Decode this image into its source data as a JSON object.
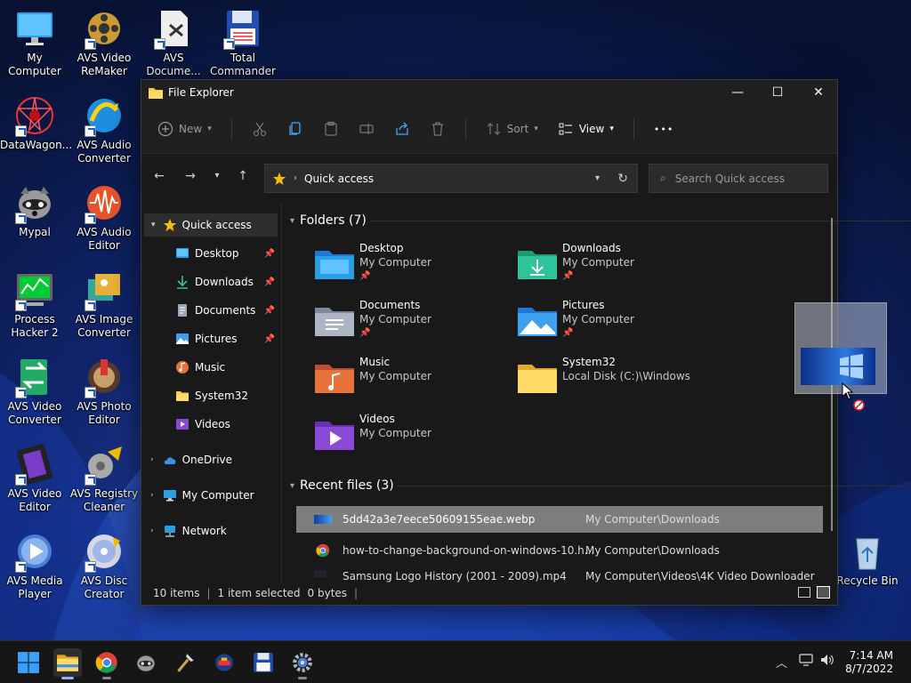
{
  "desktop": {
    "icons": [
      {
        "label": "My Computer"
      },
      {
        "label": "AVS Video ReMaker"
      },
      {
        "label": "AVS Docume..."
      },
      {
        "label": "Total Commander"
      },
      {
        "label": "DataWagon..."
      },
      {
        "label": "AVS Audio Converter"
      },
      {
        "label": "Mypal"
      },
      {
        "label": "AVS Audio Editor"
      },
      {
        "label": "Process Hacker 2"
      },
      {
        "label": "AVS Image Converter"
      },
      {
        "label": "AVS Video Converter"
      },
      {
        "label": "AVS Photo Editor"
      },
      {
        "label": "AVS Video Editor"
      },
      {
        "label": "AVS Registry Cleaner"
      },
      {
        "label": "AVS Media Player"
      },
      {
        "label": "AVS Disc Creator"
      },
      {
        "label": "Recycle Bin"
      }
    ]
  },
  "window": {
    "title": "File Explorer",
    "controls": {
      "minimize": "—",
      "maximize": "☐",
      "close": "✕"
    }
  },
  "toolbar": {
    "new_label": "New",
    "sort_label": "Sort",
    "view_label": "View",
    "more_label": "•••"
  },
  "address": {
    "crumb": "Quick access",
    "search_placeholder": "Search Quick access"
  },
  "nav": {
    "quick_access": "Quick access",
    "items": [
      {
        "label": "Desktop",
        "pinned": true
      },
      {
        "label": "Downloads",
        "pinned": true
      },
      {
        "label": "Documents",
        "pinned": true
      },
      {
        "label": "Pictures",
        "pinned": true
      },
      {
        "label": "Music",
        "pinned": false
      },
      {
        "label": "System32",
        "pinned": false
      },
      {
        "label": "Videos",
        "pinned": false
      }
    ],
    "onedrive": "OneDrive",
    "mycomputer": "My Computer",
    "network": "Network"
  },
  "content": {
    "folders_header": "Folders (7)",
    "folders": [
      {
        "name": "Desktop",
        "path": "My Computer"
      },
      {
        "name": "Downloads",
        "path": "My Computer"
      },
      {
        "name": "Documents",
        "path": "My Computer"
      },
      {
        "name": "Pictures",
        "path": "My Computer"
      },
      {
        "name": "Music",
        "path": "My Computer"
      },
      {
        "name": "System32",
        "path": "Local Disk (C:)\\Windows"
      },
      {
        "name": "Videos",
        "path": "My Computer"
      }
    ],
    "recent_header": "Recent files (3)",
    "recent": [
      {
        "name": "5dd42a3e7eece50609155eae.webp",
        "path": "My Computer\\Downloads"
      },
      {
        "name": "how-to-change-background-on-windows-10.h...",
        "path": "My Computer\\Downloads"
      },
      {
        "name": "Samsung Logo History (2001 - 2009).mp4",
        "path": "My Computer\\Videos\\4K Video Downloader"
      }
    ]
  },
  "status": {
    "items": "10 items",
    "selected": "1 item selected",
    "size": "0 bytes"
  },
  "taskbar": {
    "time": "7:14 AM",
    "date": "8/7/2022"
  },
  "colors": {
    "accent": "#0078d4",
    "folder_yellow": "#f5c84a",
    "window_bg": "#191919"
  }
}
